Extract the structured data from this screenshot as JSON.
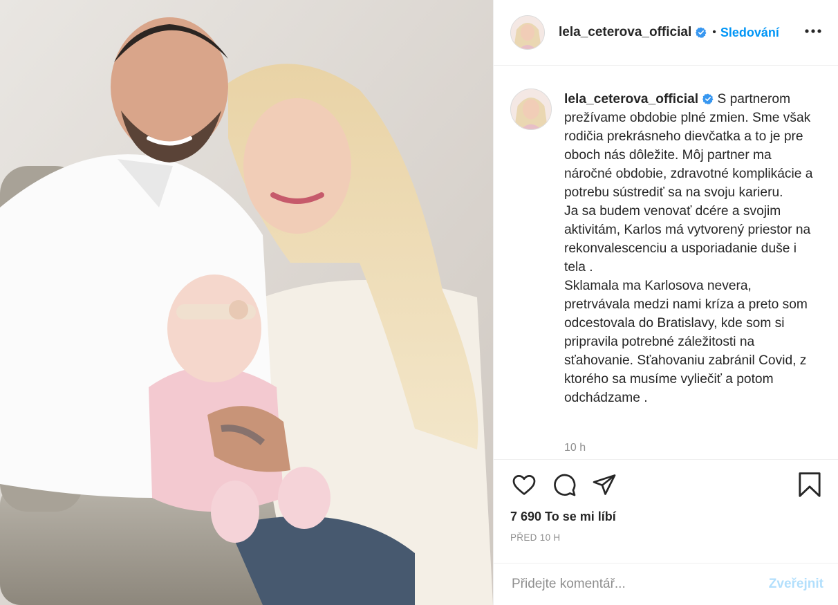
{
  "post": {
    "author": {
      "username": "lela_ceterova_official",
      "verified": true
    },
    "header": {
      "follow_label": "Sledování",
      "separator": "•"
    },
    "caption": {
      "text": "S partnerom prežívame obdobie plné zmien. Sme však rodičia prekrásneho dievčatka a to je pre oboch nás dôležite. Môj partner ma náročné obdobie, zdravotné komplikácie a potrebu sústrediť sa na svoju karieru.\nJa sa budem venovať dcére a svojim aktivitám, Karlos má vytvorený priestor na rekonvalescenciu a usporiadanie duše i tela .\nSklamala ma Karlosova nevera, pretrvávala medzi nami kríza a preto som odcestovala do Bratislavy, kde som si pripravila potrebné záležitosti na sťahovanie. Sťahovaniu zabránil Covid, z ktorého sa musíme vyliečiť a potom odchádzame .",
      "time": "10 h"
    },
    "actions": {
      "like_icon": "heart-icon",
      "comment_icon": "comment-icon",
      "share_icon": "paper-plane-icon",
      "save_icon": "bookmark-icon"
    },
    "likes": "7 690 To se mi líbí",
    "age": "PŘED 10 H",
    "comment_box": {
      "placeholder": "Přidejte komentář...",
      "submit_label": "Zveřejnit"
    },
    "colors": {
      "link": "#0095f6",
      "submit_disabled": "#b2dffc",
      "muted": "#8e8e8e",
      "text": "#262626",
      "verified": "#3897f0"
    }
  }
}
